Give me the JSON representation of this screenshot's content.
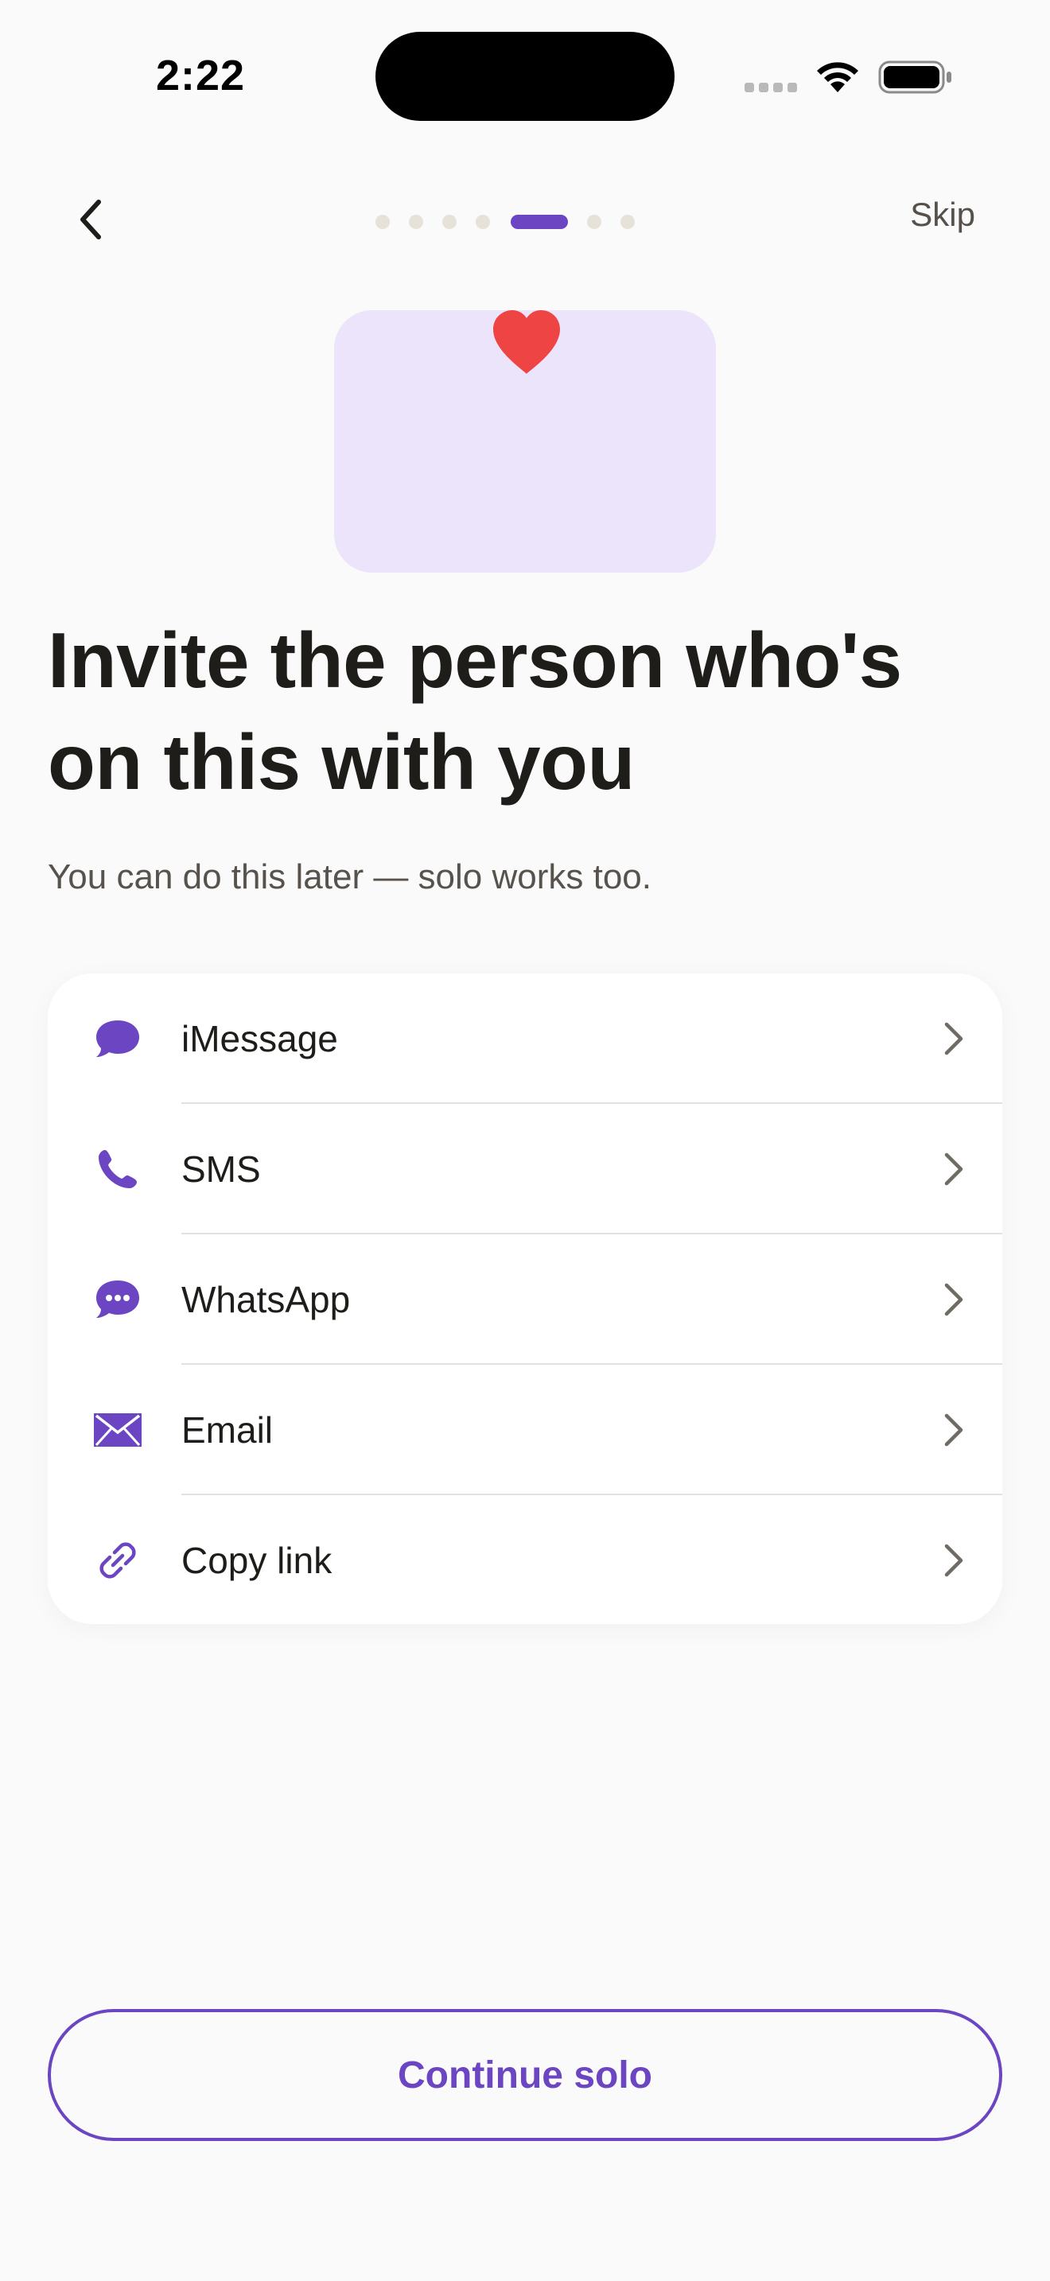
{
  "status_bar": {
    "time": "2:22"
  },
  "nav": {
    "back_icon": "chevron-left-icon",
    "skip_label": "Skip",
    "progress": {
      "total_steps": 7,
      "current_step": 5
    }
  },
  "illustration": {
    "icon": "heart-icon",
    "heart_color": "#ef4444",
    "background_color": "#ece4fa"
  },
  "main": {
    "title_line1": "Invite the person who's",
    "title_line2": "on this with you",
    "subtitle": "You can do this later — solo works too."
  },
  "share_options": [
    {
      "label": "iMessage",
      "icon": "message-bubble-icon"
    },
    {
      "label": "SMS",
      "icon": "phone-icon"
    },
    {
      "label": "WhatsApp",
      "icon": "chat-dots-icon"
    },
    {
      "label": "Email",
      "icon": "envelope-icon"
    },
    {
      "label": "Copy link",
      "icon": "link-icon"
    }
  ],
  "footer": {
    "continue_label": "Continue solo"
  },
  "colors": {
    "accent": "#6b45c2",
    "background": "#fafafa",
    "card": "#ffffff",
    "text_primary": "#1f1d1a",
    "text_secondary": "#57524c"
  }
}
